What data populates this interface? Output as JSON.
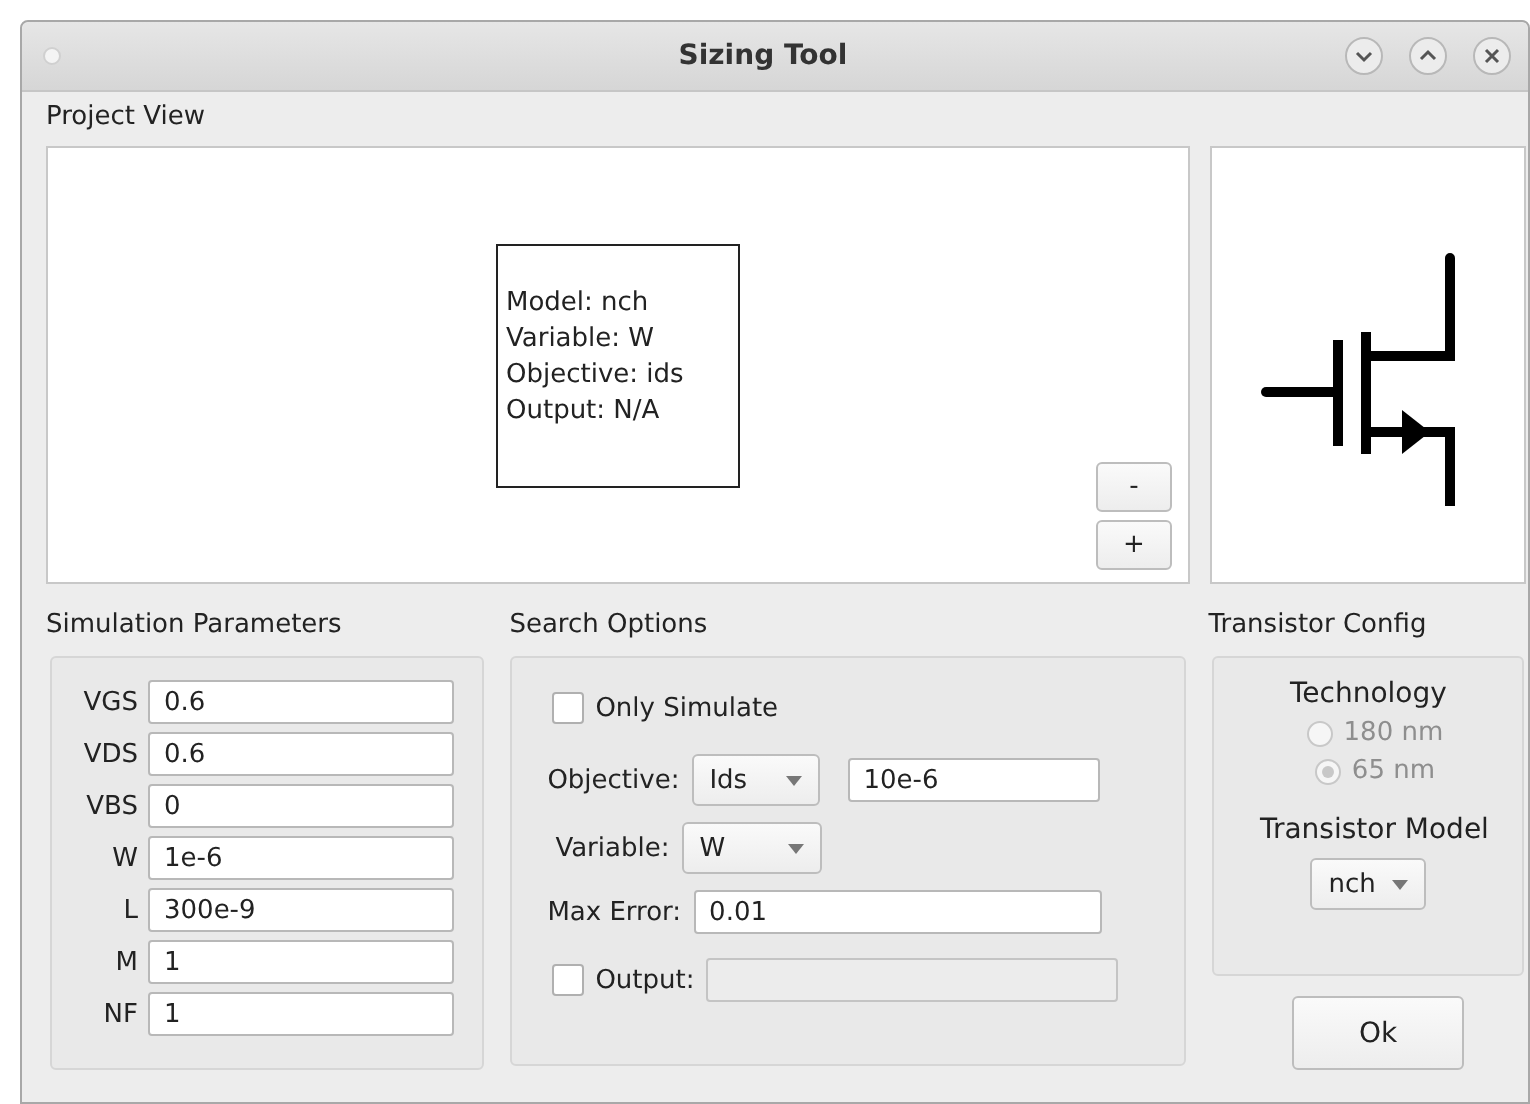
{
  "window": {
    "title": "Sizing Tool"
  },
  "project_view": {
    "label": "Project View",
    "node": {
      "lines": [
        "Model: nch",
        "Variable: W",
        "Objective: ids",
        "Output: N/A"
      ]
    },
    "zoom_buttons": [
      "-",
      "+"
    ]
  },
  "simulation_parameters": {
    "label": "Simulation Parameters",
    "params": [
      {
        "name": "VGS",
        "value": "0.6"
      },
      {
        "name": "VDS",
        "value": "0.6"
      },
      {
        "name": "VBS",
        "value": "0"
      },
      {
        "name": "W",
        "value": "1e-6"
      },
      {
        "name": "L",
        "value": "300e-9"
      },
      {
        "name": "M",
        "value": "1"
      },
      {
        "name": "NF",
        "value": "1"
      }
    ]
  },
  "search_options": {
    "label": "Search Options",
    "only_simulate": {
      "label": "Only Simulate",
      "checked": false
    },
    "objective": {
      "label": "Objective:",
      "choice": "Ids",
      "value": "10e-6"
    },
    "variable": {
      "label": "Variable:",
      "choice": "W"
    },
    "max_error": {
      "label": "Max Error:",
      "value": "0.01"
    },
    "output": {
      "label": "Output:",
      "checked": false,
      "disabled": true
    }
  },
  "transistor_config": {
    "label": "Transistor Config",
    "technology": {
      "label": "Technology",
      "disabled": true,
      "options": [
        {
          "label": "180 nm",
          "selected": false
        },
        {
          "label": "65 nm",
          "selected": true
        }
      ]
    },
    "model": {
      "label": "Transistor Model",
      "choice": "nch"
    }
  },
  "ok_button": "Ok"
}
